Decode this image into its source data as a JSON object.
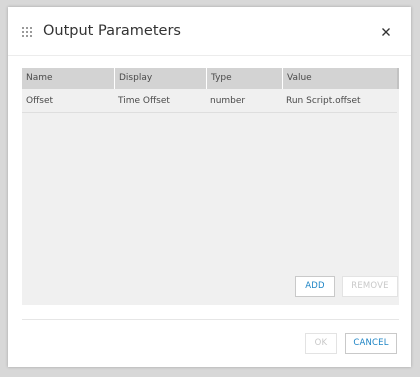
{
  "dialog": {
    "title": "Output Parameters",
    "close_icon": "close-icon",
    "grip_icon": "drag-handle-icon"
  },
  "table": {
    "columns": [
      "Name",
      "Display",
      "Type",
      "Value"
    ],
    "rows": [
      {
        "name": "Offset",
        "display": "Time Offset",
        "type": "number",
        "value": "Run Script.offset"
      }
    ]
  },
  "actions": {
    "add_label": "ADD",
    "remove_label": "REMOVE"
  },
  "footer": {
    "ok_label": "OK",
    "cancel_label": "CANCEL"
  },
  "colors": {
    "accent": "#1d84c5",
    "disabled": "#c8c8c8",
    "table_header": "#d3d3d3",
    "panel": "#f0f0f0"
  }
}
